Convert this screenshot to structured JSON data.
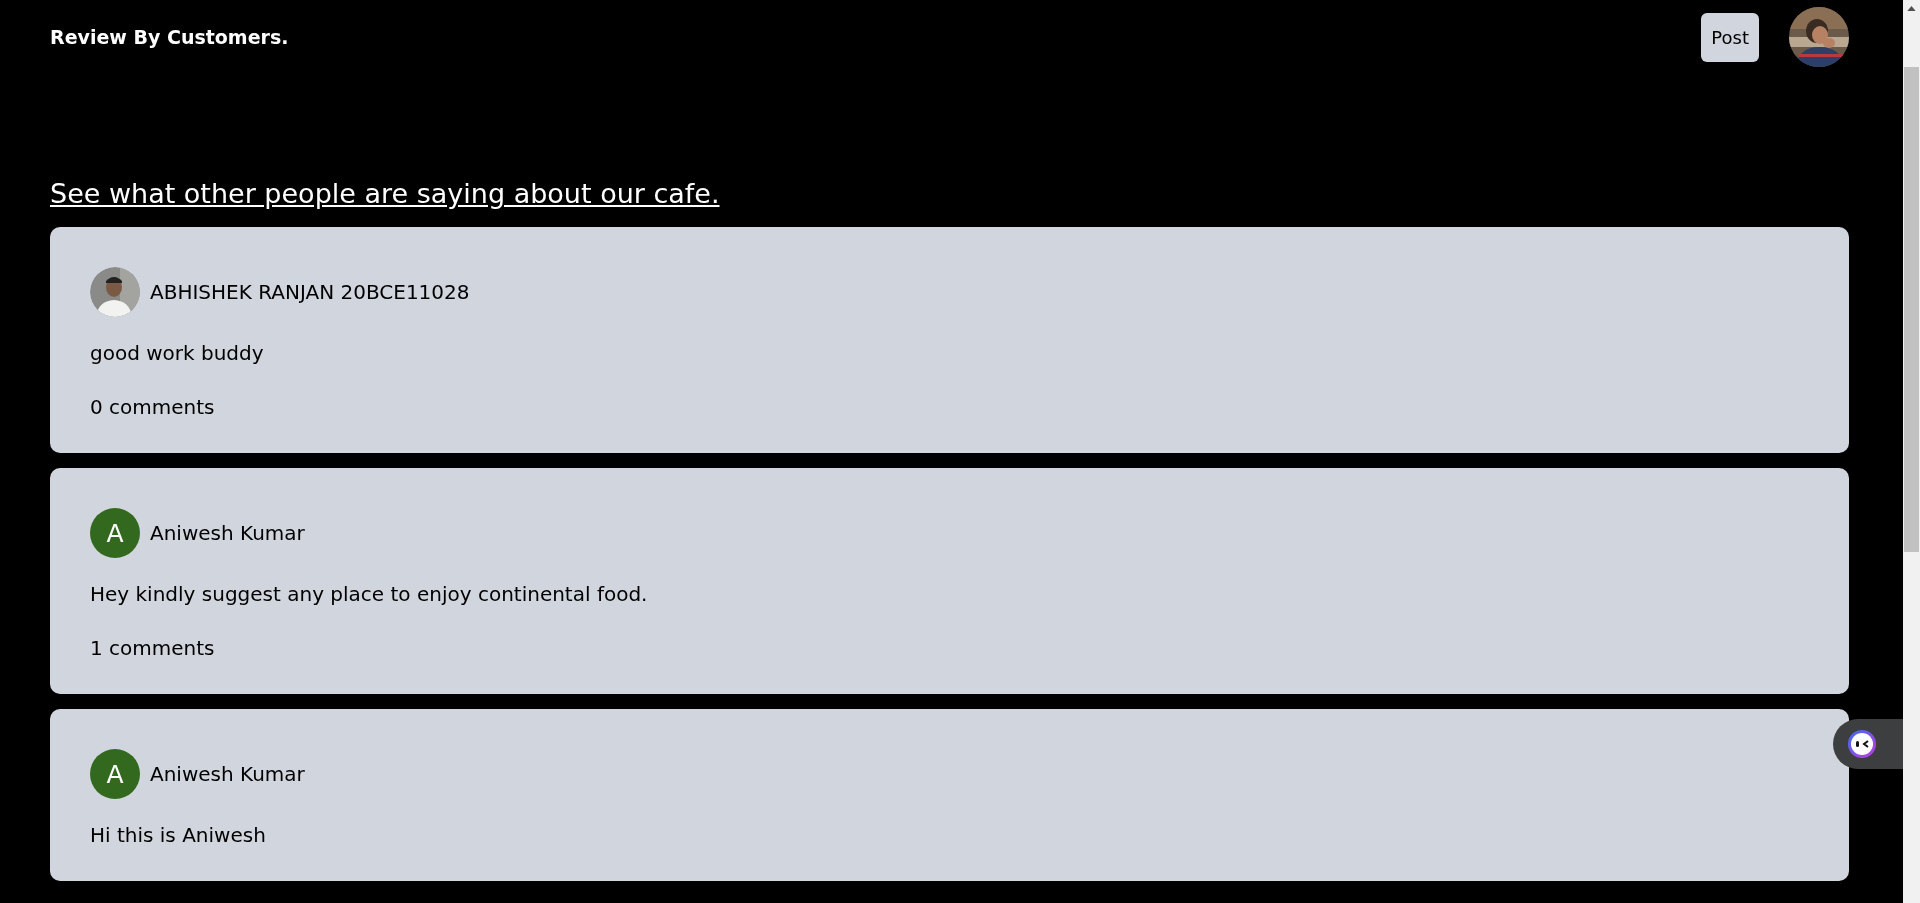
{
  "header": {
    "title": "Review By Customers.",
    "post_button": "Post"
  },
  "heading": "See what other people are saying about our cafe.",
  "reviews": [
    {
      "author": "ABHISHEK RANJAN 20BCE11028",
      "text": "good work buddy",
      "comments": "0 comments"
    },
    {
      "author": "Aniwesh Kumar",
      "avatar": {
        "kind": "letter",
        "letter": "A",
        "color": "#33691e"
      },
      "text": "Hey kindly suggest any place to enjoy continental food.",
      "comments": "1 comments"
    },
    {
      "author": "Aniwesh Kumar",
      "avatar": {
        "kind": "letter",
        "letter": "A",
        "color": "#33691e"
      },
      "text": "Hi this is Aniwesh"
    }
  ]
}
